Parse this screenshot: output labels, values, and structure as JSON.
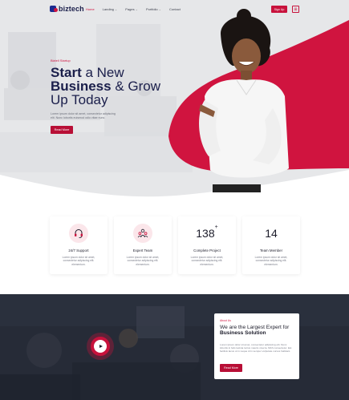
{
  "brand": {
    "name": "biztech",
    "accent": "#c8123c",
    "navy": "#1b1f4b"
  },
  "nav": {
    "items": [
      {
        "label": "Home",
        "active": true,
        "dropdown": false
      },
      {
        "label": "Landing",
        "active": false,
        "dropdown": true
      },
      {
        "label": "Pages",
        "active": false,
        "dropdown": true
      },
      {
        "label": "Portfolio",
        "active": false,
        "dropdown": true
      },
      {
        "label": "Contact",
        "active": false,
        "dropdown": false
      }
    ],
    "signup_label": "Sign Up",
    "grid_icon": "grid-icon"
  },
  "hero": {
    "eyebrow": "Biztell Startup",
    "headline": {
      "w1": "Start",
      "w2": " a New",
      "w3": "Business",
      "w4": " & Grow",
      "w5": "Up Today"
    },
    "description": "Lorem ipsum dolor sit amet, consectetur adipiscing elit. Nunc lobortis euismod odio vitae nunc.",
    "button_label": "Read More"
  },
  "features": [
    {
      "icon": "headset-icon",
      "title": "24/7 Support",
      "desc": "Lorem ipsum dolor sit amet, consectetur adipiscing elit. elementum."
    },
    {
      "icon": "team-icon",
      "title": "Expert Team",
      "desc": "Lorem ipsum dolor sit amet, consectetur adipiscing elit. elementum."
    },
    {
      "number": "138",
      "sup": "+",
      "title": "Complete Project",
      "desc": "Lorem ipsum dolor sit amet, consectetur adipiscing elit. elementum."
    },
    {
      "number": "14",
      "title": "Team Member",
      "desc": "Lorem ipsum dolor sit amet, consectetur adipiscing elit. elementum."
    }
  ],
  "about": {
    "eyebrow": "About Us",
    "title_line1": "We are the Largest Expert for",
    "title_line2": "Business Solution",
    "description": "Lorem ipsum dolor sit amet, consectetur adipiscing elit. Nunc lobortis in felis lacinia luctus mauris viverra. Nibh consectetur. Est facilisis lacus ut in neque id in semper vulputate cursus habitant.",
    "button_label": "Read More"
  }
}
